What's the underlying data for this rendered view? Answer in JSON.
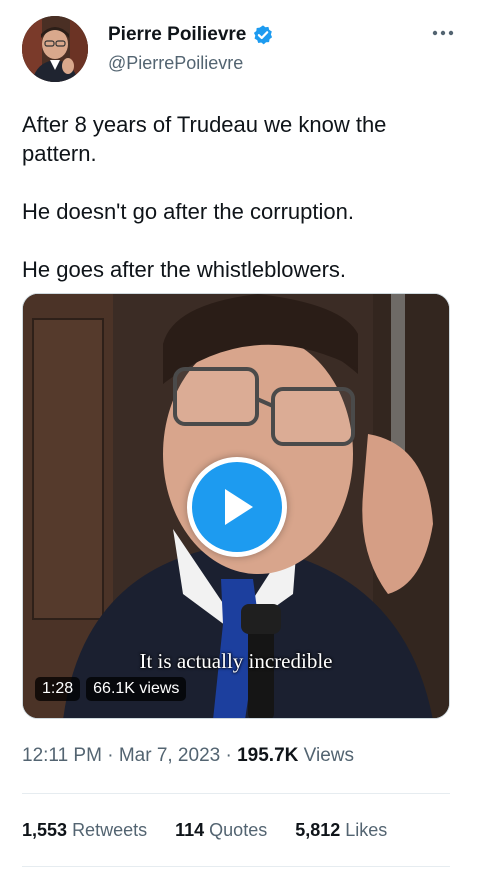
{
  "author": {
    "name": "Pierre Poilievre",
    "handle": "@PierrePoilievre"
  },
  "more_icon": "more-dots-icon",
  "tweet": {
    "paragraphs": [
      "After 8 years of Trudeau we know the pattern.",
      "He doesn't go after the corruption.",
      "He goes after the whistleblowers."
    ]
  },
  "video": {
    "caption": "It is actually incredible",
    "duration": "1:28",
    "views": "66.1K views"
  },
  "meta": {
    "time": "12:11 PM",
    "date": "Mar 7, 2023",
    "separator": "·",
    "views_count": "195.7K",
    "views_label": "Views"
  },
  "stats": {
    "retweets_count": "1,553",
    "retweets_label": "Retweets",
    "quotes_count": "114",
    "quotes_label": "Quotes",
    "likes_count": "5,812",
    "likes_label": "Likes"
  },
  "colors": {
    "verified": "#1d9bf0",
    "play_button": "#1d9bf0",
    "secondary_text": "#536471"
  }
}
